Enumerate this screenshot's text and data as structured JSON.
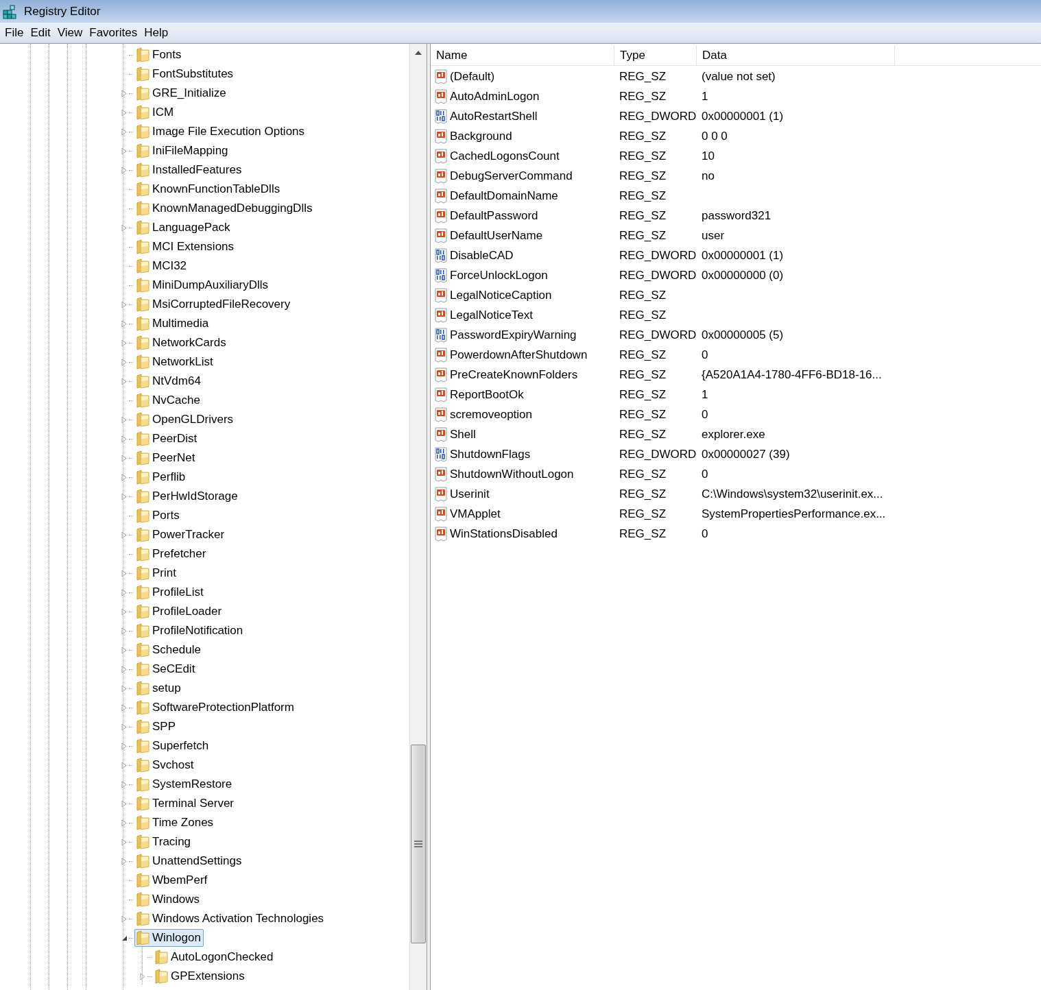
{
  "window": {
    "title": "Registry Editor"
  },
  "menu": [
    "File",
    "Edit",
    "View",
    "Favorites",
    "Help"
  ],
  "tree": [
    {
      "label": "Fonts",
      "expandable": false,
      "expanded": false,
      "selected": false
    },
    {
      "label": "FontSubstitutes",
      "expandable": false,
      "expanded": false,
      "selected": false
    },
    {
      "label": "GRE_Initialize",
      "expandable": true,
      "expanded": false,
      "selected": false
    },
    {
      "label": "ICM",
      "expandable": true,
      "expanded": false,
      "selected": false
    },
    {
      "label": "Image File Execution Options",
      "expandable": true,
      "expanded": false,
      "selected": false
    },
    {
      "label": "IniFileMapping",
      "expandable": true,
      "expanded": false,
      "selected": false
    },
    {
      "label": "InstalledFeatures",
      "expandable": true,
      "expanded": false,
      "selected": false
    },
    {
      "label": "KnownFunctionTableDlls",
      "expandable": false,
      "expanded": false,
      "selected": false
    },
    {
      "label": "KnownManagedDebuggingDlls",
      "expandable": false,
      "expanded": false,
      "selected": false
    },
    {
      "label": "LanguagePack",
      "expandable": true,
      "expanded": false,
      "selected": false
    },
    {
      "label": "MCI Extensions",
      "expandable": false,
      "expanded": false,
      "selected": false
    },
    {
      "label": "MCI32",
      "expandable": false,
      "expanded": false,
      "selected": false
    },
    {
      "label": "MiniDumpAuxiliaryDlls",
      "expandable": false,
      "expanded": false,
      "selected": false
    },
    {
      "label": "MsiCorruptedFileRecovery",
      "expandable": true,
      "expanded": false,
      "selected": false
    },
    {
      "label": "Multimedia",
      "expandable": true,
      "expanded": false,
      "selected": false
    },
    {
      "label": "NetworkCards",
      "expandable": true,
      "expanded": false,
      "selected": false
    },
    {
      "label": "NetworkList",
      "expandable": true,
      "expanded": false,
      "selected": false
    },
    {
      "label": "NtVdm64",
      "expandable": true,
      "expanded": false,
      "selected": false
    },
    {
      "label": "NvCache",
      "expandable": false,
      "expanded": false,
      "selected": false
    },
    {
      "label": "OpenGLDrivers",
      "expandable": true,
      "expanded": false,
      "selected": false
    },
    {
      "label": "PeerDist",
      "expandable": true,
      "expanded": false,
      "selected": false
    },
    {
      "label": "PeerNet",
      "expandable": true,
      "expanded": false,
      "selected": false
    },
    {
      "label": "Perflib",
      "expandable": true,
      "expanded": false,
      "selected": false
    },
    {
      "label": "PerHwIdStorage",
      "expandable": true,
      "expanded": false,
      "selected": false
    },
    {
      "label": "Ports",
      "expandable": false,
      "expanded": false,
      "selected": false
    },
    {
      "label": "PowerTracker",
      "expandable": true,
      "expanded": false,
      "selected": false
    },
    {
      "label": "Prefetcher",
      "expandable": false,
      "expanded": false,
      "selected": false
    },
    {
      "label": "Print",
      "expandable": true,
      "expanded": false,
      "selected": false
    },
    {
      "label": "ProfileList",
      "expandable": true,
      "expanded": false,
      "selected": false
    },
    {
      "label": "ProfileLoader",
      "expandable": true,
      "expanded": false,
      "selected": false
    },
    {
      "label": "ProfileNotification",
      "expandable": true,
      "expanded": false,
      "selected": false
    },
    {
      "label": "Schedule",
      "expandable": true,
      "expanded": false,
      "selected": false
    },
    {
      "label": "SeCEdit",
      "expandable": true,
      "expanded": false,
      "selected": false
    },
    {
      "label": "setup",
      "expandable": true,
      "expanded": false,
      "selected": false
    },
    {
      "label": "SoftwareProtectionPlatform",
      "expandable": true,
      "expanded": false,
      "selected": false
    },
    {
      "label": "SPP",
      "expandable": true,
      "expanded": false,
      "selected": false
    },
    {
      "label": "Superfetch",
      "expandable": true,
      "expanded": false,
      "selected": false
    },
    {
      "label": "Svchost",
      "expandable": true,
      "expanded": false,
      "selected": false
    },
    {
      "label": "SystemRestore",
      "expandable": true,
      "expanded": false,
      "selected": false
    },
    {
      "label": "Terminal Server",
      "expandable": true,
      "expanded": false,
      "selected": false
    },
    {
      "label": "Time Zones",
      "expandable": true,
      "expanded": false,
      "selected": false
    },
    {
      "label": "Tracing",
      "expandable": true,
      "expanded": false,
      "selected": false
    },
    {
      "label": "UnattendSettings",
      "expandable": true,
      "expanded": false,
      "selected": false
    },
    {
      "label": "WbemPerf",
      "expandable": false,
      "expanded": false,
      "selected": false
    },
    {
      "label": "Windows",
      "expandable": false,
      "expanded": false,
      "selected": false
    },
    {
      "label": "Windows Activation Technologies",
      "expandable": true,
      "expanded": false,
      "selected": false
    },
    {
      "label": "Winlogon",
      "expandable": true,
      "expanded": true,
      "selected": true,
      "children": [
        {
          "label": "AutoLogonChecked",
          "expandable": false,
          "expanded": false,
          "selected": false
        },
        {
          "label": "GPExtensions",
          "expandable": true,
          "expanded": false,
          "selected": false
        }
      ]
    }
  ],
  "table": {
    "columns": [
      "Name",
      "Type",
      "Data"
    ],
    "rows": [
      {
        "kind": "string",
        "name": "(Default)",
        "type": "REG_SZ",
        "data": "(value not set)"
      },
      {
        "kind": "string",
        "name": "AutoAdminLogon",
        "type": "REG_SZ",
        "data": "1"
      },
      {
        "kind": "dword",
        "name": "AutoRestartShell",
        "type": "REG_DWORD",
        "data": "0x00000001 (1)"
      },
      {
        "kind": "string",
        "name": "Background",
        "type": "REG_SZ",
        "data": "0 0 0"
      },
      {
        "kind": "string",
        "name": "CachedLogonsCount",
        "type": "REG_SZ",
        "data": "10"
      },
      {
        "kind": "string",
        "name": "DebugServerCommand",
        "type": "REG_SZ",
        "data": "no"
      },
      {
        "kind": "string",
        "name": "DefaultDomainName",
        "type": "REG_SZ"
      },
      {
        "kind": "string",
        "name": "DefaultPassword",
        "type": "REG_SZ",
        "data": "password321"
      },
      {
        "kind": "string",
        "name": "DefaultUserName",
        "type": "REG_SZ",
        "data": "user"
      },
      {
        "kind": "dword",
        "name": "DisableCAD",
        "type": "REG_DWORD",
        "data": "0x00000001 (1)"
      },
      {
        "kind": "dword",
        "name": "ForceUnlockLogon",
        "type": "REG_DWORD",
        "data": "0x00000000 (0)"
      },
      {
        "kind": "string",
        "name": "LegalNoticeCaption",
        "type": "REG_SZ"
      },
      {
        "kind": "string",
        "name": "LegalNoticeText",
        "type": "REG_SZ"
      },
      {
        "kind": "dword",
        "name": "PasswordExpiryWarning",
        "type": "REG_DWORD",
        "data": "0x00000005 (5)"
      },
      {
        "kind": "string",
        "name": "PowerdownAfterShutdown",
        "type": "REG_SZ",
        "data": "0"
      },
      {
        "kind": "string",
        "name": "PreCreateKnownFolders",
        "type": "REG_SZ",
        "data": "{A520A1A4-1780-4FF6-BD18-16..."
      },
      {
        "kind": "string",
        "name": "ReportBootOk",
        "type": "REG_SZ",
        "data": "1"
      },
      {
        "kind": "string",
        "name": "scremoveoption",
        "type": "REG_SZ",
        "data": "0"
      },
      {
        "kind": "string",
        "name": "Shell",
        "type": "REG_SZ",
        "data": "explorer.exe"
      },
      {
        "kind": "dword",
        "name": "ShutdownFlags",
        "type": "REG_DWORD",
        "data": "0x00000027 (39)"
      },
      {
        "kind": "string",
        "name": "ShutdownWithoutLogon",
        "type": "REG_SZ",
        "data": "0"
      },
      {
        "kind": "string",
        "name": "Userinit",
        "type": "REG_SZ",
        "data": "C:\\Windows\\system32\\userinit.ex..."
      },
      {
        "kind": "string",
        "name": "VMApplet",
        "type": "REG_SZ",
        "data": "SystemPropertiesPerformance.ex..."
      },
      {
        "kind": "string",
        "name": "WinStationsDisabled",
        "type": "REG_SZ",
        "data": "0"
      }
    ]
  }
}
